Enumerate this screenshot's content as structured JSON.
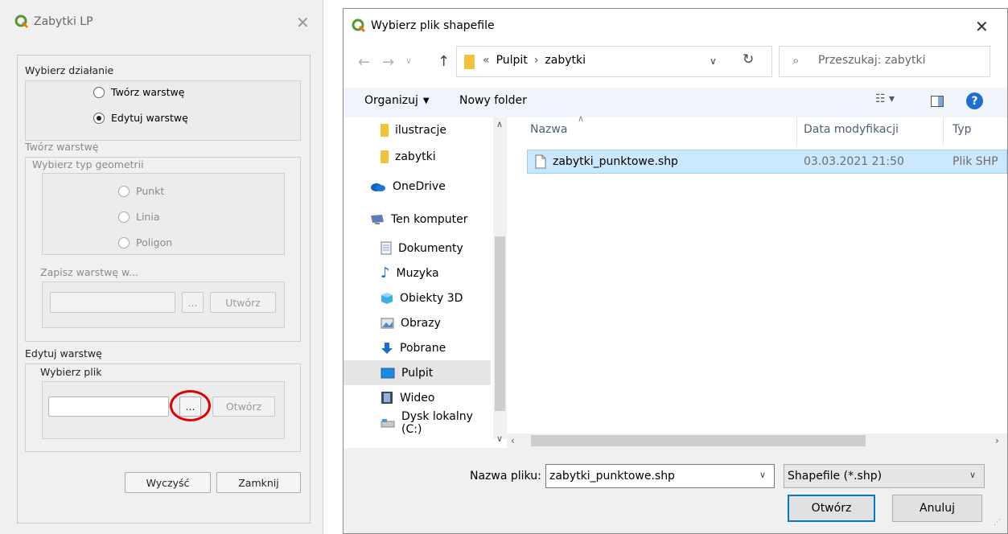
{
  "left_dialog": {
    "title": "Zabytki LP",
    "section_action": "Wybierz działanie",
    "radio_create": "Twórz warstwę",
    "radio_edit": "Edytuj warstwę",
    "section_create": "Twórz warstwę",
    "geometry_group": "Wybierz typ geometrii",
    "geom_point": "Punkt",
    "geom_line": "Linia",
    "geom_polygon": "Poligon",
    "save_group": "Zapisz warstwę w...",
    "browse_label": "...",
    "create_button": "Utwórz",
    "section_edit": "Edytuj warstwę",
    "file_group": "Wybierz plik",
    "open_button": "Otwórz",
    "clear_button": "Wyczyść",
    "close_button": "Zamknij"
  },
  "file_dialog": {
    "title": "Wybierz plik shapefile",
    "breadcrumb_prefix": "«",
    "breadcrumb": [
      "Pulpit",
      "zabytki"
    ],
    "search_placeholder": "Przeszukaj: zabytki",
    "organize": "Organizuj",
    "new_folder": "Nowy folder",
    "nav_items": [
      {
        "label": "ilustracje",
        "icon": "folder-icon"
      },
      {
        "label": "zabytki",
        "icon": "folder-icon"
      },
      {
        "label": "OneDrive",
        "icon": "cloud-icon"
      },
      {
        "label": "Ten komputer",
        "icon": "computer-icon"
      },
      {
        "label": "Dokumenty",
        "icon": "document-icon"
      },
      {
        "label": "Muzyka",
        "icon": "music-icon"
      },
      {
        "label": "Obiekty 3D",
        "icon": "cube-icon"
      },
      {
        "label": "Obrazy",
        "icon": "picture-icon"
      },
      {
        "label": "Pobrane",
        "icon": "download-icon"
      },
      {
        "label": "Pulpit",
        "icon": "desktop-icon"
      },
      {
        "label": "Wideo",
        "icon": "video-icon"
      },
      {
        "label": "Dysk lokalny (C:)",
        "icon": "drive-icon"
      }
    ],
    "columns": [
      "Nazwa",
      "Data modyfikacji",
      "Typ"
    ],
    "files": [
      {
        "name": "zabytki_punktowe.shp",
        "date": "03.03.2021 21:50",
        "type": "Plik SHP"
      }
    ],
    "filename_label": "Nazwa pliku:",
    "filename_value": "zabytki_punktowe.shp",
    "filter_value": "Shapefile (*.shp)",
    "open_button": "Otwórz",
    "cancel_button": "Anuluj"
  },
  "colors": {
    "qgis_green": "#589632",
    "selection_blue": "#cce8ff",
    "annotation_red": "#e00000",
    "help_blue": "#1e6fd0"
  }
}
